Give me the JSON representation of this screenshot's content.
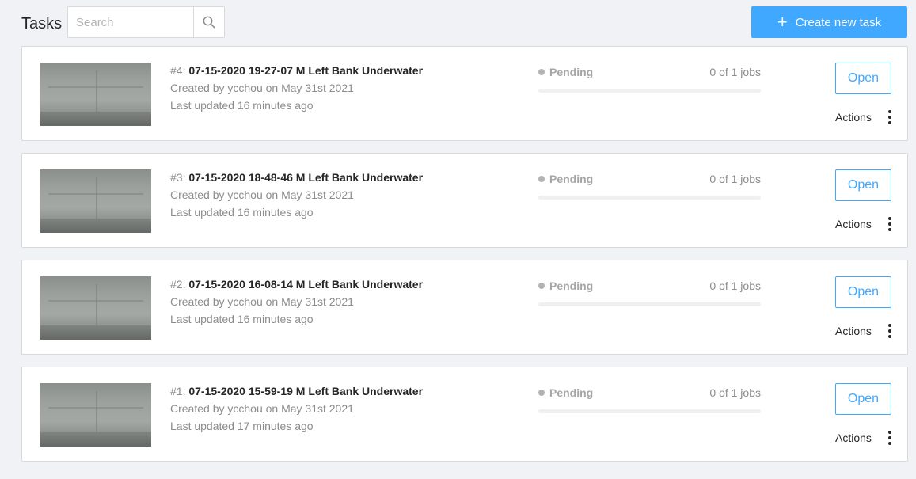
{
  "header": {
    "title": "Tasks",
    "search_placeholder": "Search",
    "search_value": "",
    "create_label": "Create new task"
  },
  "colors": {
    "primary": "#40a9ff",
    "pending_dot": "#b3b3b3"
  },
  "tasks": [
    {
      "num": "#4: ",
      "title": "07-15-2020 19-27-07 M Left Bank Underwater",
      "created": "Created by ycchou on May 31st 2021",
      "updated": "Last updated 16 minutes ago",
      "status": "Pending",
      "jobs": "0 of 1 jobs",
      "progress": 0,
      "open_label": "Open",
      "actions_label": "Actions"
    },
    {
      "num": "#3: ",
      "title": "07-15-2020 18-48-46 M Left Bank Underwater",
      "created": "Created by ycchou on May 31st 2021",
      "updated": "Last updated 16 minutes ago",
      "status": "Pending",
      "jobs": "0 of 1 jobs",
      "progress": 0,
      "open_label": "Open",
      "actions_label": "Actions"
    },
    {
      "num": "#2: ",
      "title": "07-15-2020 16-08-14 M Left Bank Underwater",
      "created": "Created by ycchou on May 31st 2021",
      "updated": "Last updated 16 minutes ago",
      "status": "Pending",
      "jobs": "0 of 1 jobs",
      "progress": 0,
      "open_label": "Open",
      "actions_label": "Actions"
    },
    {
      "num": "#1: ",
      "title": "07-15-2020 15-59-19 M Left Bank Underwater",
      "created": "Created by ycchou on May 31st 2021",
      "updated": "Last updated 17 minutes ago",
      "status": "Pending",
      "jobs": "0 of 1 jobs",
      "progress": 0,
      "open_label": "Open",
      "actions_label": "Actions"
    }
  ]
}
